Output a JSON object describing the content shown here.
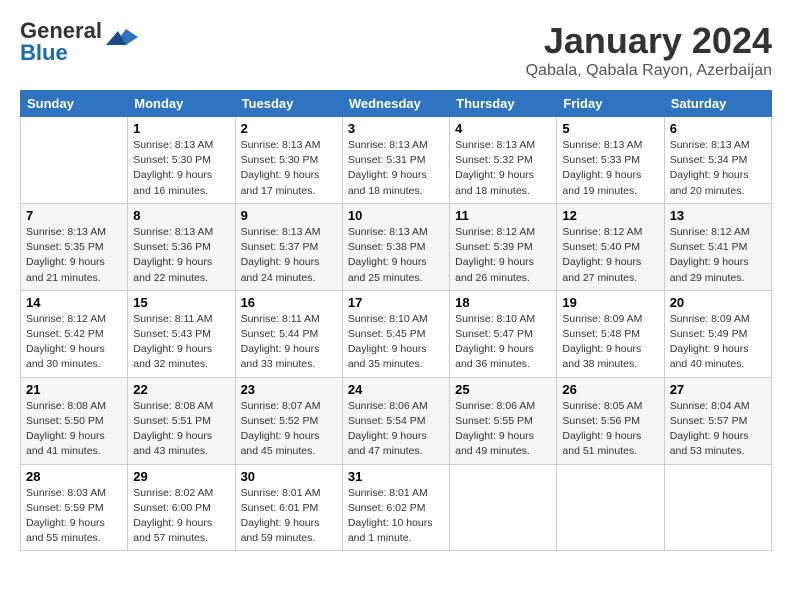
{
  "logo": {
    "part1": "General",
    "part2": "Blue"
  },
  "title": "January 2024",
  "location": "Qabala, Qabala Rayon, Azerbaijan",
  "days_header": [
    "Sunday",
    "Monday",
    "Tuesday",
    "Wednesday",
    "Thursday",
    "Friday",
    "Saturday"
  ],
  "weeks": [
    [
      {
        "day": "",
        "info": ""
      },
      {
        "day": "1",
        "info": "Sunrise: 8:13 AM\nSunset: 5:30 PM\nDaylight: 9 hours\nand 16 minutes."
      },
      {
        "day": "2",
        "info": "Sunrise: 8:13 AM\nSunset: 5:30 PM\nDaylight: 9 hours\nand 17 minutes."
      },
      {
        "day": "3",
        "info": "Sunrise: 8:13 AM\nSunset: 5:31 PM\nDaylight: 9 hours\nand 18 minutes."
      },
      {
        "day": "4",
        "info": "Sunrise: 8:13 AM\nSunset: 5:32 PM\nDaylight: 9 hours\nand 18 minutes."
      },
      {
        "day": "5",
        "info": "Sunrise: 8:13 AM\nSunset: 5:33 PM\nDaylight: 9 hours\nand 19 minutes."
      },
      {
        "day": "6",
        "info": "Sunrise: 8:13 AM\nSunset: 5:34 PM\nDaylight: 9 hours\nand 20 minutes."
      }
    ],
    [
      {
        "day": "7",
        "info": "Sunrise: 8:13 AM\nSunset: 5:35 PM\nDaylight: 9 hours\nand 21 minutes."
      },
      {
        "day": "8",
        "info": "Sunrise: 8:13 AM\nSunset: 5:36 PM\nDaylight: 9 hours\nand 22 minutes."
      },
      {
        "day": "9",
        "info": "Sunrise: 8:13 AM\nSunset: 5:37 PM\nDaylight: 9 hours\nand 24 minutes."
      },
      {
        "day": "10",
        "info": "Sunrise: 8:13 AM\nSunset: 5:38 PM\nDaylight: 9 hours\nand 25 minutes."
      },
      {
        "day": "11",
        "info": "Sunrise: 8:12 AM\nSunset: 5:39 PM\nDaylight: 9 hours\nand 26 minutes."
      },
      {
        "day": "12",
        "info": "Sunrise: 8:12 AM\nSunset: 5:40 PM\nDaylight: 9 hours\nand 27 minutes."
      },
      {
        "day": "13",
        "info": "Sunrise: 8:12 AM\nSunset: 5:41 PM\nDaylight: 9 hours\nand 29 minutes."
      }
    ],
    [
      {
        "day": "14",
        "info": "Sunrise: 8:12 AM\nSunset: 5:42 PM\nDaylight: 9 hours\nand 30 minutes."
      },
      {
        "day": "15",
        "info": "Sunrise: 8:11 AM\nSunset: 5:43 PM\nDaylight: 9 hours\nand 32 minutes."
      },
      {
        "day": "16",
        "info": "Sunrise: 8:11 AM\nSunset: 5:44 PM\nDaylight: 9 hours\nand 33 minutes."
      },
      {
        "day": "17",
        "info": "Sunrise: 8:10 AM\nSunset: 5:45 PM\nDaylight: 9 hours\nand 35 minutes."
      },
      {
        "day": "18",
        "info": "Sunrise: 8:10 AM\nSunset: 5:47 PM\nDaylight: 9 hours\nand 36 minutes."
      },
      {
        "day": "19",
        "info": "Sunrise: 8:09 AM\nSunset: 5:48 PM\nDaylight: 9 hours\nand 38 minutes."
      },
      {
        "day": "20",
        "info": "Sunrise: 8:09 AM\nSunset: 5:49 PM\nDaylight: 9 hours\nand 40 minutes."
      }
    ],
    [
      {
        "day": "21",
        "info": "Sunrise: 8:08 AM\nSunset: 5:50 PM\nDaylight: 9 hours\nand 41 minutes."
      },
      {
        "day": "22",
        "info": "Sunrise: 8:08 AM\nSunset: 5:51 PM\nDaylight: 9 hours\nand 43 minutes."
      },
      {
        "day": "23",
        "info": "Sunrise: 8:07 AM\nSunset: 5:52 PM\nDaylight: 9 hours\nand 45 minutes."
      },
      {
        "day": "24",
        "info": "Sunrise: 8:06 AM\nSunset: 5:54 PM\nDaylight: 9 hours\nand 47 minutes."
      },
      {
        "day": "25",
        "info": "Sunrise: 8:06 AM\nSunset: 5:55 PM\nDaylight: 9 hours\nand 49 minutes."
      },
      {
        "day": "26",
        "info": "Sunrise: 8:05 AM\nSunset: 5:56 PM\nDaylight: 9 hours\nand 51 minutes."
      },
      {
        "day": "27",
        "info": "Sunrise: 8:04 AM\nSunset: 5:57 PM\nDaylight: 9 hours\nand 53 minutes."
      }
    ],
    [
      {
        "day": "28",
        "info": "Sunrise: 8:03 AM\nSunset: 5:59 PM\nDaylight: 9 hours\nand 55 minutes."
      },
      {
        "day": "29",
        "info": "Sunrise: 8:02 AM\nSunset: 6:00 PM\nDaylight: 9 hours\nand 57 minutes."
      },
      {
        "day": "30",
        "info": "Sunrise: 8:01 AM\nSunset: 6:01 PM\nDaylight: 9 hours\nand 59 minutes."
      },
      {
        "day": "31",
        "info": "Sunrise: 8:01 AM\nSunset: 6:02 PM\nDaylight: 10 hours\nand 1 minute."
      },
      {
        "day": "",
        "info": ""
      },
      {
        "day": "",
        "info": ""
      },
      {
        "day": "",
        "info": ""
      }
    ]
  ]
}
